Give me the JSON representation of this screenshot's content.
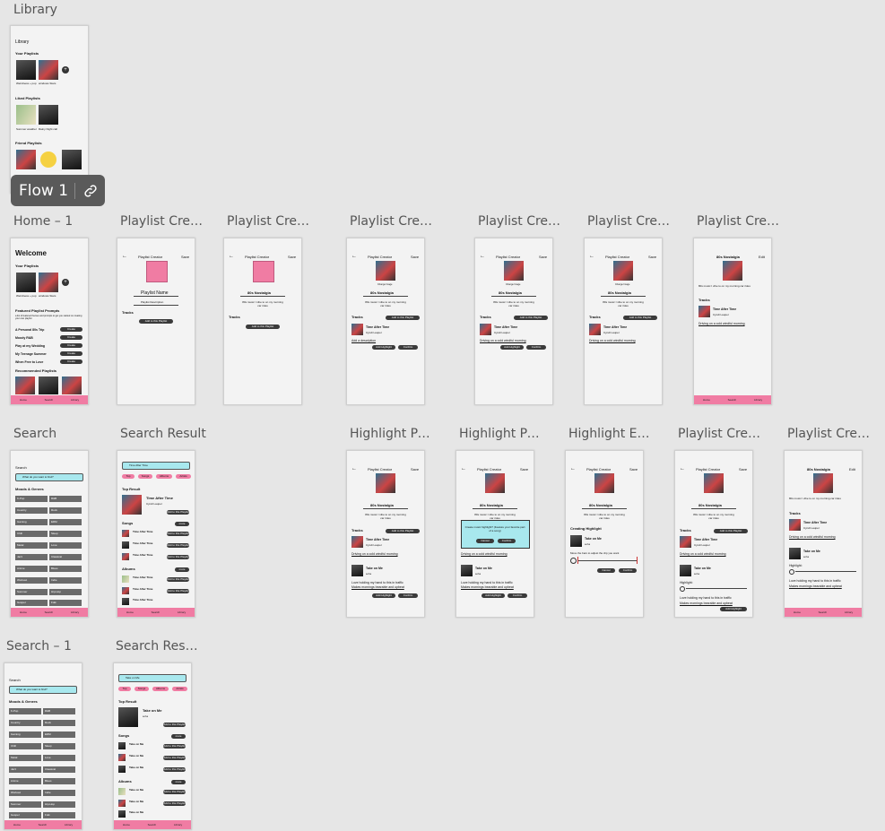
{
  "frame_labels": {
    "library": "Library",
    "home1": "Home – 1",
    "pc1": "Playlist Crea...",
    "pc2": "Playlist Crea...",
    "pc3": "Playlist Crea...",
    "pc4": "Playlist Crea...",
    "pc5": "Playlist Crea...",
    "pc6": "Playlist Crea...",
    "search": "Search",
    "search_result": "Search Result",
    "hp1": "Highlight Po...",
    "hp2": "Highlight Po...",
    "he": "Highlight Ed...",
    "pc7": "Playlist Crea...",
    "pc8": "Playlist Crea...",
    "search1": "Search – 1",
    "search_result2": "Search Resu..."
  },
  "flow_badge": {
    "label": "Flow 1",
    "icon": "link-icon"
  },
  "library": {
    "title": "Library",
    "your_playlists": "Your Playlists",
    "p1": "Weirdness + pop",
    "p2": "windows Stars",
    "liked": "Liked Playlists",
    "l1": "Summer weather",
    "l2": "Rainy Night call",
    "friend": "Friend Playlists"
  },
  "home": {
    "title": "Welcome",
    "your_playlists": "Your Playlists",
    "p1": "Weirdness + pop",
    "p2": "windows Stars",
    "featured": "Featured Playlist Prompts",
    "featured_desc": "a list of featured themes and prompts to get you started on creating your own playlist",
    "prompts": [
      "A Personal 80s Trip",
      "Moody R&B",
      "Play at my Wedding",
      "My Teenage Summer",
      "When Free to Love"
    ],
    "create": "Create",
    "recommended": "Recommended Playlists"
  },
  "nav": {
    "home": "Home",
    "search": "Search",
    "library": "Library"
  },
  "pc": {
    "header": "Playlist Creator",
    "save": "Save",
    "edit": "Edit",
    "change_image": "Change Image",
    "name_placeholder": "Playlist Name",
    "desc_placeholder": "Playlist Description",
    "name": "80s Nostalgia",
    "desc": "80s music I vibe to on my morning car rides",
    "tracks": "Tracks",
    "add_to_playlist": "Add to this Playlist",
    "track1": "Time After Time",
    "artist1": "Cyndi Lauper",
    "annot": "Add a description",
    "annot2": "Driving on a cold windful morning",
    "add_highlight": "Add Highlight",
    "confirm": "Confirm",
    "cancel": "Cancel",
    "track2": "Take on Me",
    "artist2": "a-ha",
    "annot3": "Love holding my hand to this in traffic",
    "annot4": "Makes mornings bearable and upbeat",
    "highlight": "Highlight:",
    "creating_highlight": "Creating Highlight",
    "move_bars": "Move the bars to adjust the clip you want",
    "dialog": "Create music highlight? (Feature your favorite part of a song)"
  },
  "search": {
    "title": "Search",
    "placeholder": "What do you want to find?",
    "moods": "Moods & Genres",
    "genres": [
      "K-Pop",
      "R&B",
      "Country",
      "Rock",
      "Gaming",
      "EDM",
      "Chill",
      "Sleep",
      "Metal",
      "Love",
      "Jazz",
      "Classical",
      "Anime",
      "Blues",
      "Workout",
      "Indie",
      "Summer",
      "Hip-Hop",
      "Gospel",
      "Folk"
    ]
  },
  "search_result": {
    "query": "Time After Time",
    "chips": [
      "Top",
      "Songs",
      "Albums",
      "Artists"
    ],
    "top_result": "Top Result",
    "top_title": "Time After Time",
    "top_artist": "Cyndi Lauper",
    "songs": "Songs",
    "more": "more",
    "song_rows": [
      "Time After Time",
      "Time After Time",
      "Time After Time"
    ],
    "albums": "Albums",
    "album_rows": [
      "Time After Time",
      "Time After Time",
      "Time After Time"
    ]
  },
  "search_result2": {
    "query": "Take on Me",
    "top_title": "Take on Me",
    "top_artist": "a-ha",
    "song_rows": [
      "Take on Me",
      "Take on Me",
      "Take on Me"
    ],
    "album_rows": [
      "Take on Me",
      "Take on Me",
      "Take on Me"
    ]
  }
}
